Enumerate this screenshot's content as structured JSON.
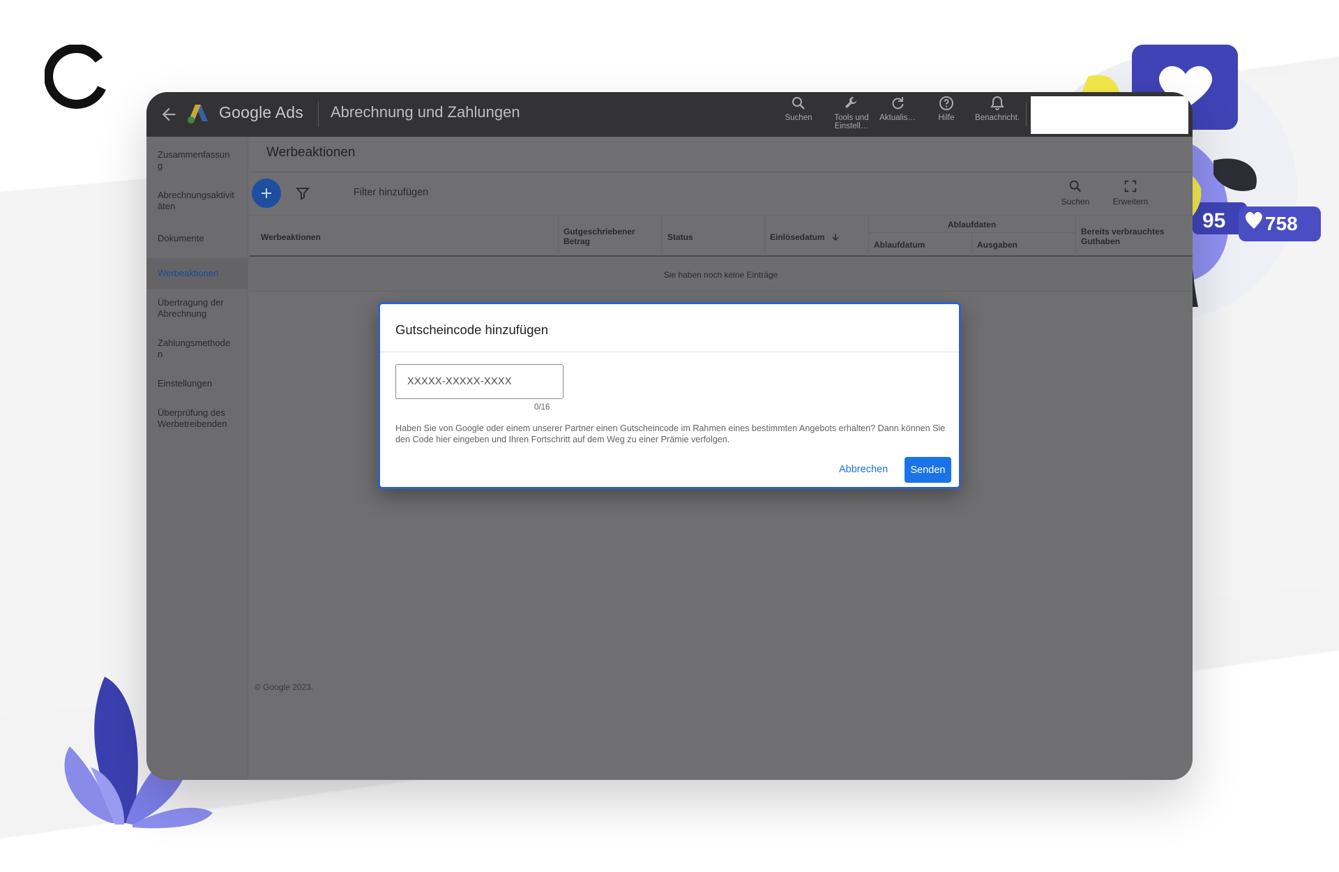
{
  "topbar": {
    "brand": "Google Ads",
    "section_title": "Abrechnung und Zahlungen",
    "buttons": [
      {
        "label": "Suchen",
        "icon": "search-icon"
      },
      {
        "label": "Tools und Einstell…",
        "icon": "wrench-icon"
      },
      {
        "label": "Aktualis…",
        "icon": "refresh-icon"
      },
      {
        "label": "Hilfe",
        "icon": "help-icon"
      },
      {
        "label": "Benachricht.",
        "icon": "bell-icon"
      }
    ]
  },
  "sidebar": {
    "items": [
      {
        "label": "Zusammenfassung",
        "display": "Zusammenfassu\nng"
      },
      {
        "label": "Abrechnungsaktivitäten",
        "display": "Abrechnungsaktiv\nitäten"
      },
      {
        "label": "Dokumente",
        "display": "Dokumente"
      },
      {
        "label": "Werbeaktionen",
        "display": "Werbeaktionen",
        "active": true
      },
      {
        "label": "Übertragung der Abrechnung",
        "display": "Übertragung der\nAbrechnung"
      },
      {
        "label": "Zahlungsmethoden",
        "display": "Zahlungsmethod\nen"
      },
      {
        "label": "Einstellungen",
        "display": "Einstellungen"
      },
      {
        "label": "Überprüfung des Werbetreibenden",
        "display": "Überprüfung des\nWerbetreibenden"
      }
    ]
  },
  "main": {
    "title": "Werbeaktionen",
    "filter_label": "Filter hinzufügen",
    "tools": [
      {
        "label": "Suchen",
        "icon": "search-icon"
      },
      {
        "label": "Erweitern",
        "icon": "expand-icon"
      }
    ],
    "table": {
      "columns": {
        "promotions": "Werbeaktionen",
        "credited_amount": "Gutgeschriebener Betrag",
        "status": "Status",
        "redemption_date": "Einlösedatum",
        "expiry_group": "Ablaufdaten",
        "expiry_date": "Ablaufdatum",
        "spend": "Ausgaben",
        "used_credit": "Bereits verbrauchtes Guthaben"
      },
      "empty_text": "Sie haben noch keine Einträge"
    },
    "footer": "© Google 2023."
  },
  "dialog": {
    "title": "Gutscheincode hinzufügen",
    "input_placeholder": "XXXXX-XXXXX-XXXX",
    "input_value": "",
    "counter": "0/16",
    "description": "Haben Sie von Google oder einem unserer Partner einen Gutscheincode im Rahmen eines bestimmten Angebots erhalten? Dann können Sie den Code hier eingeben und Ihren Fortschritt auf dem Weg zu einer Prämie verfolgen.",
    "cancel_label": "Abbrechen",
    "submit_label": "Senden"
  },
  "decoration": {
    "followers_count": "95",
    "likes_count": "758"
  },
  "colors": {
    "accent_blue": "#1a73e8",
    "topbar": "#333335",
    "overlay": "#6f6f71",
    "deco_purple": "#7b7ee6",
    "deco_navy": "#3a3fb0",
    "deco_yellow": "#f1e94a"
  }
}
